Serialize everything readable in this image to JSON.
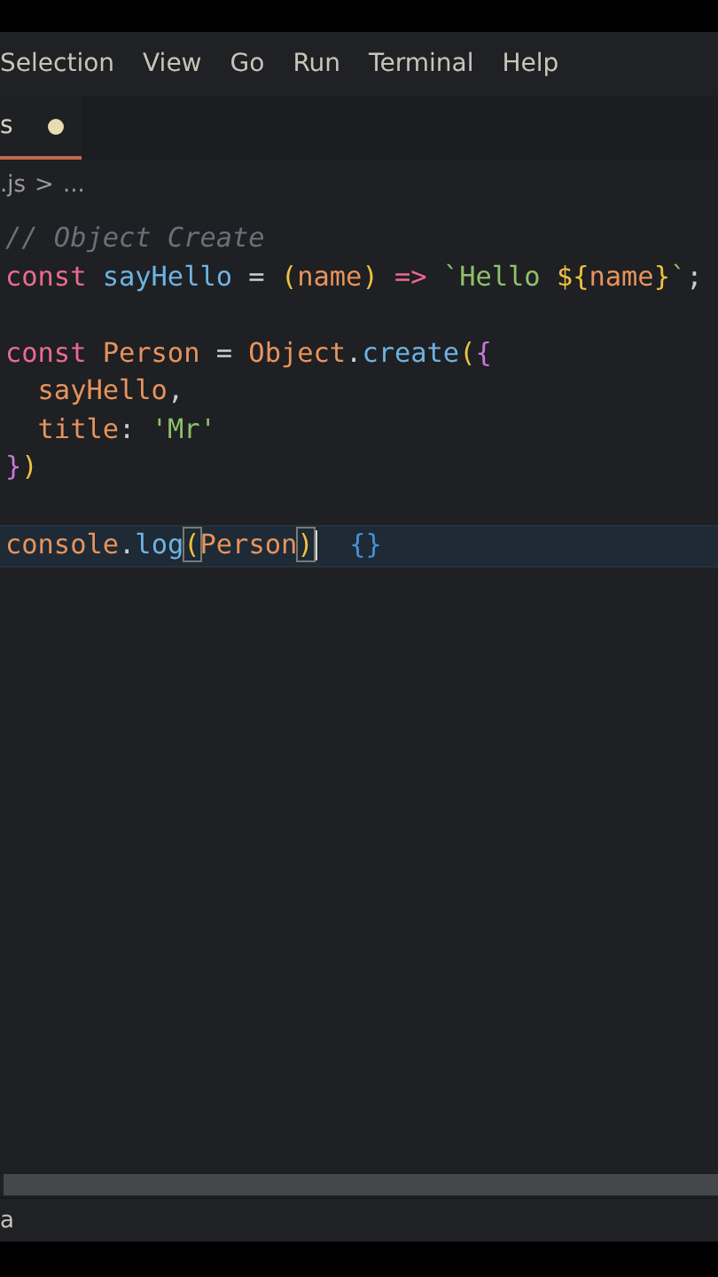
{
  "menu": [
    "Selection",
    "View",
    "Go",
    "Run",
    "Terminal",
    "Help"
  ],
  "tab": {
    "label": "s",
    "modified": true,
    "selected": true
  },
  "breadcrumb": {
    "file": ".js",
    "separator": ">",
    "rest": "..."
  },
  "editor": {
    "lines": [
      {
        "current": false,
        "tokens": [
          {
            "kind": "comment",
            "text": "// Object Create"
          }
        ]
      },
      {
        "current": false,
        "tokens": [
          {
            "kind": "keyword",
            "text": "const"
          },
          {
            "kind": "function",
            "text": " sayHello"
          },
          {
            "kind": "plain",
            "text": " = "
          },
          {
            "kind": "paren",
            "text": "("
          },
          {
            "kind": "variable",
            "text": "name"
          },
          {
            "kind": "paren",
            "text": ")"
          },
          {
            "kind": "keyword",
            "text": " =>"
          },
          {
            "kind": "string",
            "text": " `Hello "
          },
          {
            "kind": "paren",
            "text": "${"
          },
          {
            "kind": "variable",
            "text": "name"
          },
          {
            "kind": "paren",
            "text": "}"
          },
          {
            "kind": "string",
            "text": "`"
          },
          {
            "kind": "plain",
            "text": ";"
          }
        ]
      },
      {
        "current": false
      },
      {
        "current": false,
        "tokens": [
          {
            "kind": "keyword",
            "text": "const"
          },
          {
            "kind": "variable",
            "text": " Person"
          },
          {
            "kind": "plain",
            "text": " = "
          },
          {
            "kind": "variable",
            "text": "Object"
          },
          {
            "kind": "plain",
            "text": "."
          },
          {
            "kind": "function",
            "text": "create"
          },
          {
            "kind": "paren",
            "text": "("
          },
          {
            "kind": "brace",
            "text": "{"
          }
        ]
      },
      {
        "current": false,
        "tokens": [
          {
            "kind": "variable",
            "text": "  sayHello"
          },
          {
            "kind": "plain",
            "text": ","
          }
        ]
      },
      {
        "current": false,
        "tokens": [
          {
            "kind": "variable",
            "text": "  title"
          },
          {
            "kind": "plain",
            "text": ": "
          },
          {
            "kind": "string",
            "text": "'Mr'"
          }
        ]
      },
      {
        "current": false,
        "tokens": [
          {
            "kind": "brace",
            "text": "}"
          },
          {
            "kind": "paren",
            "text": ")"
          }
        ]
      },
      {
        "current": false
      },
      {
        "current": true,
        "tokens": [
          {
            "kind": "variable",
            "text": "console"
          },
          {
            "kind": "plain",
            "text": "."
          },
          {
            "kind": "function",
            "text": "log"
          },
          {
            "kind": "match",
            "text": "("
          },
          {
            "kind": "variable",
            "text": "Person"
          },
          {
            "kind": "match",
            "text": ")"
          },
          {
            "kind": "cursor"
          },
          {
            "kind": "hint",
            "text": "  {}"
          }
        ]
      }
    ]
  },
  "status_bar": {
    "text": "a"
  }
}
